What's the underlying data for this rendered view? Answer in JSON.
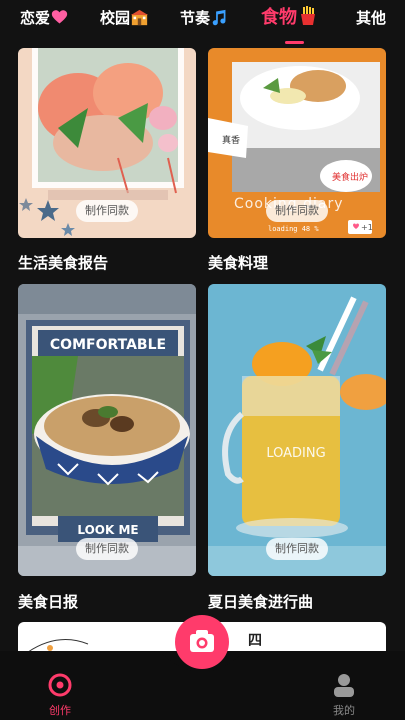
{
  "tabs": [
    {
      "label": "恋爱",
      "emoji": "heart"
    },
    {
      "label": "校园",
      "emoji": "school"
    },
    {
      "label": "节奏",
      "emoji": "music-note"
    },
    {
      "label": "食物",
      "emoji": "fries"
    },
    {
      "label": "其他",
      "emoji": ""
    }
  ],
  "active_tab": "食物",
  "cards": [
    {
      "title": "生活美食报告",
      "button": "制作同款",
      "image": "sashimi-platter"
    },
    {
      "title": "美食料理",
      "button": "制作同款",
      "image": "plated-dish",
      "badge_heart": "1",
      "sticker_text": "美食出炉",
      "caption": "Cooking diary",
      "tag": "真香",
      "progress": "loading 48 %"
    },
    {
      "title": "美食日报",
      "button": "制作同款",
      "image": "noodle-bowl",
      "overlay_top": "COMFORTABLE",
      "overlay_bottom": "LOOK ME"
    },
    {
      "title": "夏日美食进行曲",
      "button": "制作同款",
      "image": "mango-drink",
      "overlay": "LOADING"
    }
  ],
  "partial_card": {
    "text": "四"
  },
  "bottom_nav": [
    {
      "label": "创作",
      "icon": "create-icon",
      "active": true
    },
    {
      "label": "我的",
      "icon": "profile-icon",
      "active": false
    }
  ],
  "colors": {
    "accent": "#ff3b6b",
    "background": "#121212"
  }
}
